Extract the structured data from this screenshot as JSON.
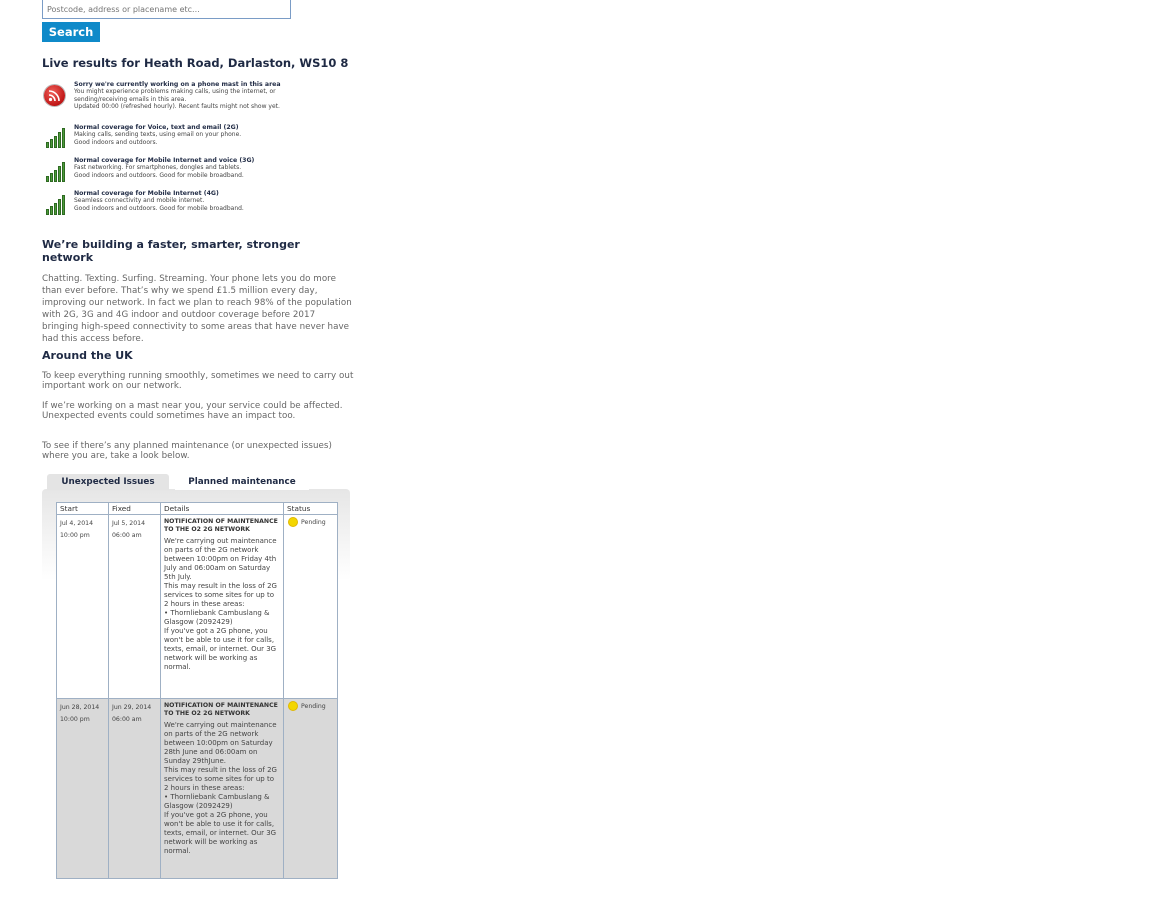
{
  "search": {
    "placeholder": "Postcode, address or placename etc...",
    "button_label": "Search"
  },
  "live": {
    "title": "Live results for Heath Road, Darlaston, WS10 8",
    "items": [
      {
        "icon": "mast-work-icon",
        "heading": "Sorry we're currently working on a phone mast in this area",
        "lines": [
          "You might experience problems making calls, using the internet, or",
          "sending/receiving emails in this area.",
          "Updated 00:00 (refreshed hourly). Recent faults might not show yet."
        ]
      },
      {
        "icon": "signal-bars-icon",
        "heading": "Normal coverage for Voice, text and email (2G)",
        "lines": [
          "Making calls, sending texts, using email on your phone.",
          "Good indoors and outdoors."
        ]
      },
      {
        "icon": "signal-bars-icon",
        "heading": "Normal coverage for Mobile Internet and voice (3G)",
        "lines": [
          "Fast networking. For smartphones, dongles and tablets.",
          "Good indoors and outdoors. Good for mobile broadband."
        ]
      },
      {
        "icon": "signal-bars-icon",
        "heading": "Normal coverage for Mobile Internet (4G)",
        "lines": [
          "Seamless connectivity and mobile internet.",
          "Good indoors and outdoors. Good for mobile broadband."
        ]
      }
    ]
  },
  "network": {
    "heading": "We’re building a faster, smarter, stronger network",
    "body": "Chatting. Texting. Surfing. Streaming. Your phone lets you do more than ever before. That’s why we spend £1.5 million every day, improving our network. In fact we plan to reach 98% of the population with 2G, 3G and 4G indoor and outdoor coverage before 2017 bringing high-speed connectivity to some areas that have never have had this access before."
  },
  "uk": {
    "heading": "Around the UK",
    "p1": "To keep everything running smoothly, sometimes we need to carry out important work on our network.",
    "p2": "If we’re working on a mast near you, your service could be affected. Unexpected events could sometimes have an impact too.",
    "p3": "To see if there’s any planned maintenance (or unexpected issues) where you are, take a look below."
  },
  "tabs": {
    "issues": "Unexpected Issues",
    "planned": "Planned maintenance"
  },
  "table": {
    "headers": [
      "Start",
      "Fixed",
      "Details",
      "Status"
    ],
    "rows": [
      {
        "start_date": "Jul 4, 2014",
        "start_time": "10:00 pm",
        "fixed_date": "Jul 5, 2014",
        "fixed_time": "06:00 am",
        "title": "NOTIFICATION OF MAINTENANCE TO THE O2 2G NETWORK",
        "body": "We're carrying out maintenance on parts of the 2G network between 10:00pm on Friday 4th July and 06:00am on Saturday 5th July.\nThis may result in the loss of 2G services to some sites for up to 2 hours in these areas:\n• Thornliebank Cambuslang & Glasgow (2092429)\nIf you've got a 2G phone, you won't be able to use it for calls, texts, email, or internet. Our 3G network will be working as normal.",
        "status": "Pending"
      },
      {
        "start_date": "Jun 28, 2014",
        "start_time": "10:00 pm",
        "fixed_date": "Jun 29, 2014",
        "fixed_time": "06:00 am",
        "title": "NOTIFICATION OF MAINTENANCE TO THE O2 2G NETWORK",
        "body": "We're carrying out maintenance on parts of the 2G network between 10:00pm on Saturday 28th June and 06:00am on Sunday 29thJune.\nThis may result in the loss of 2G services to some sites for up to 2 hours in these areas:\n• Thornliebank Cambuslang & Glasgow (2092429)\nIf you've got a 2G phone, you won't be able to use it for calls, texts, email, or internet. Our 3G network will be working as normal.",
        "status": "Pending"
      }
    ]
  },
  "colors": {
    "accent": "#0f8ac9",
    "heading": "#1f2a44",
    "signal_green": "#4c9b3a",
    "pending_yellow": "#f3d600",
    "mast_red": "#c01616"
  }
}
